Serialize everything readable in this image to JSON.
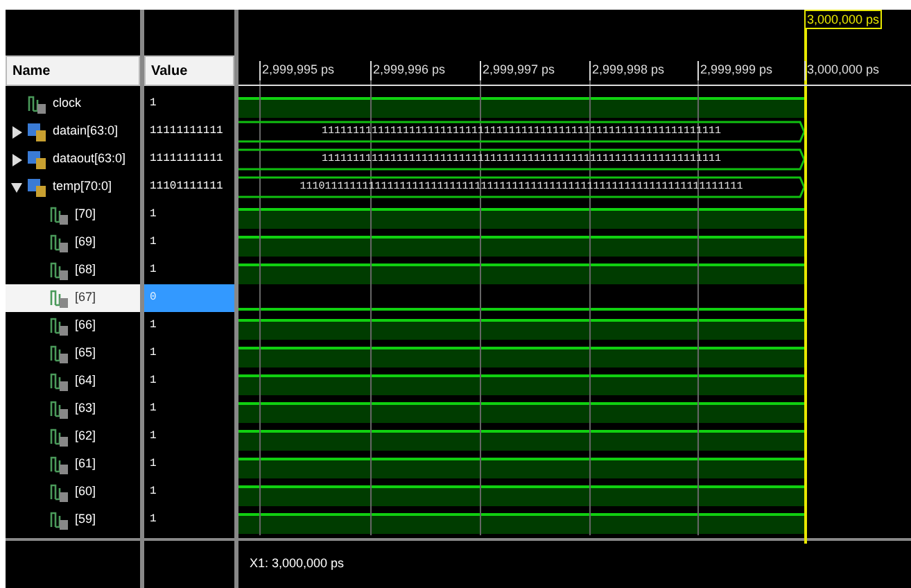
{
  "cursor_label": "3,000,000 ps",
  "columns": {
    "name": "Name",
    "value": "Value"
  },
  "timeline": [
    "2,999,995 ps",
    "2,999,996 ps",
    "2,999,997 ps",
    "2,999,998 ps",
    "2,999,999 ps",
    "3,000,000 ps"
  ],
  "signals": [
    {
      "name": "clock",
      "value": "1",
      "kind": "bit",
      "selected": false
    },
    {
      "name": "datain[63:0]",
      "value": "11111111111",
      "kind": "bus",
      "expanded": false,
      "selected": false,
      "wave_label": "1111111111111111111111111111111111111111111111111111111111111111"
    },
    {
      "name": "dataout[63:0]",
      "value": "11111111111",
      "kind": "bus",
      "expanded": false,
      "selected": false,
      "wave_label": "1111111111111111111111111111111111111111111111111111111111111111"
    },
    {
      "name": "temp[70:0]",
      "value": "11101111111",
      "kind": "bus",
      "expanded": true,
      "selected": false,
      "wave_label": "11101111111111111111111111111111111111111111111111111111111111111111111",
      "children": [
        {
          "name": "[70]",
          "value": "1",
          "kind": "bit",
          "selected": false
        },
        {
          "name": "[69]",
          "value": "1",
          "kind": "bit",
          "selected": false
        },
        {
          "name": "[68]",
          "value": "1",
          "kind": "bit",
          "selected": false
        },
        {
          "name": "[67]",
          "value": "0",
          "kind": "bit",
          "selected": true
        },
        {
          "name": "[66]",
          "value": "1",
          "kind": "bit",
          "selected": false
        },
        {
          "name": "[65]",
          "value": "1",
          "kind": "bit",
          "selected": false
        },
        {
          "name": "[64]",
          "value": "1",
          "kind": "bit",
          "selected": false
        },
        {
          "name": "[63]",
          "value": "1",
          "kind": "bit",
          "selected": false
        },
        {
          "name": "[62]",
          "value": "1",
          "kind": "bit",
          "selected": false
        },
        {
          "name": "[61]",
          "value": "1",
          "kind": "bit",
          "selected": false
        },
        {
          "name": "[60]",
          "value": "1",
          "kind": "bit",
          "selected": false
        },
        {
          "name": "[59]",
          "value": "1",
          "kind": "bit",
          "selected": false
        }
      ]
    }
  ],
  "status": "X1: 3,000,000 ps"
}
